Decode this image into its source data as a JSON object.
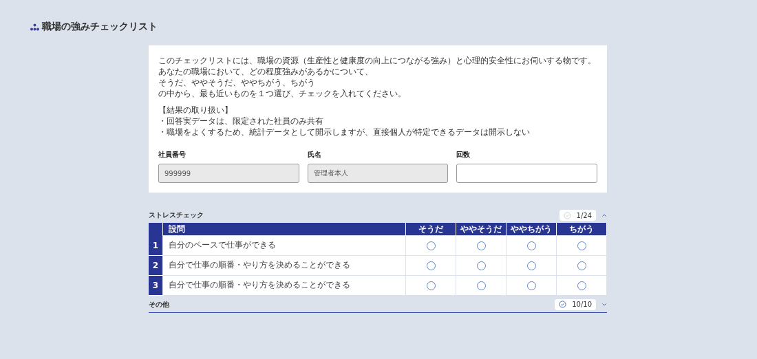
{
  "page": {
    "title": "職場の強みチェックリスト"
  },
  "intro": {
    "paragraphs": [
      [
        "このチェックリストには、職場の資源（生産性と健康度の向上につながる強み）と心理的安全性にお伺いする物です。",
        "あなたの職場において、どの程度強みがあるかについて、",
        "そうだ、ややそうだ、ややちがう、ちがう",
        "の中から、最も近いものを１つ選び、チェックを入れてください。"
      ],
      [
        "【結果の取り扱い】",
        "・回答実データは、限定された社員のみ共有",
        "・職場をよくするため、統計データとして開示しますが、直接個人が特定できるデータは開示しない"
      ]
    ]
  },
  "fields": [
    {
      "label": "社員番号",
      "value": "999999",
      "disabled": true
    },
    {
      "label": "氏名",
      "value": "管理者本人",
      "disabled": true
    },
    {
      "label": "回数",
      "disabled": false
    }
  ],
  "sections": [
    {
      "title": "ストレスチェック",
      "progress": "1/24",
      "complete": false,
      "expanded": true,
      "table": {
        "columns": [
          "設問",
          "そうだ",
          "ややそうだ",
          "ややちがう",
          "ちがう"
        ],
        "rows": [
          {
            "number": "1",
            "question": "自分のペースで仕事ができる",
            "answers": [
              {
                "selected": false
              },
              {
                "selected": false
              },
              {
                "selected": false
              },
              {
                "selected": false
              }
            ]
          },
          {
            "number": "2",
            "question": "自分で仕事の順番・やり方を決めることができる",
            "answers": [
              {
                "selected": false
              },
              {
                "selected": false
              },
              {
                "selected": false
              },
              {
                "selected": false
              }
            ]
          },
          {
            "number": "3",
            "question": "自分で仕事の順番・やり方を決めることができる",
            "answers": [
              {
                "selected": false
              },
              {
                "selected": false
              },
              {
                "selected": false
              },
              {
                "selected": false
              }
            ]
          }
        ]
      }
    },
    {
      "title": "その他",
      "progress": "10/10",
      "complete": true,
      "expanded": false
    }
  ]
}
